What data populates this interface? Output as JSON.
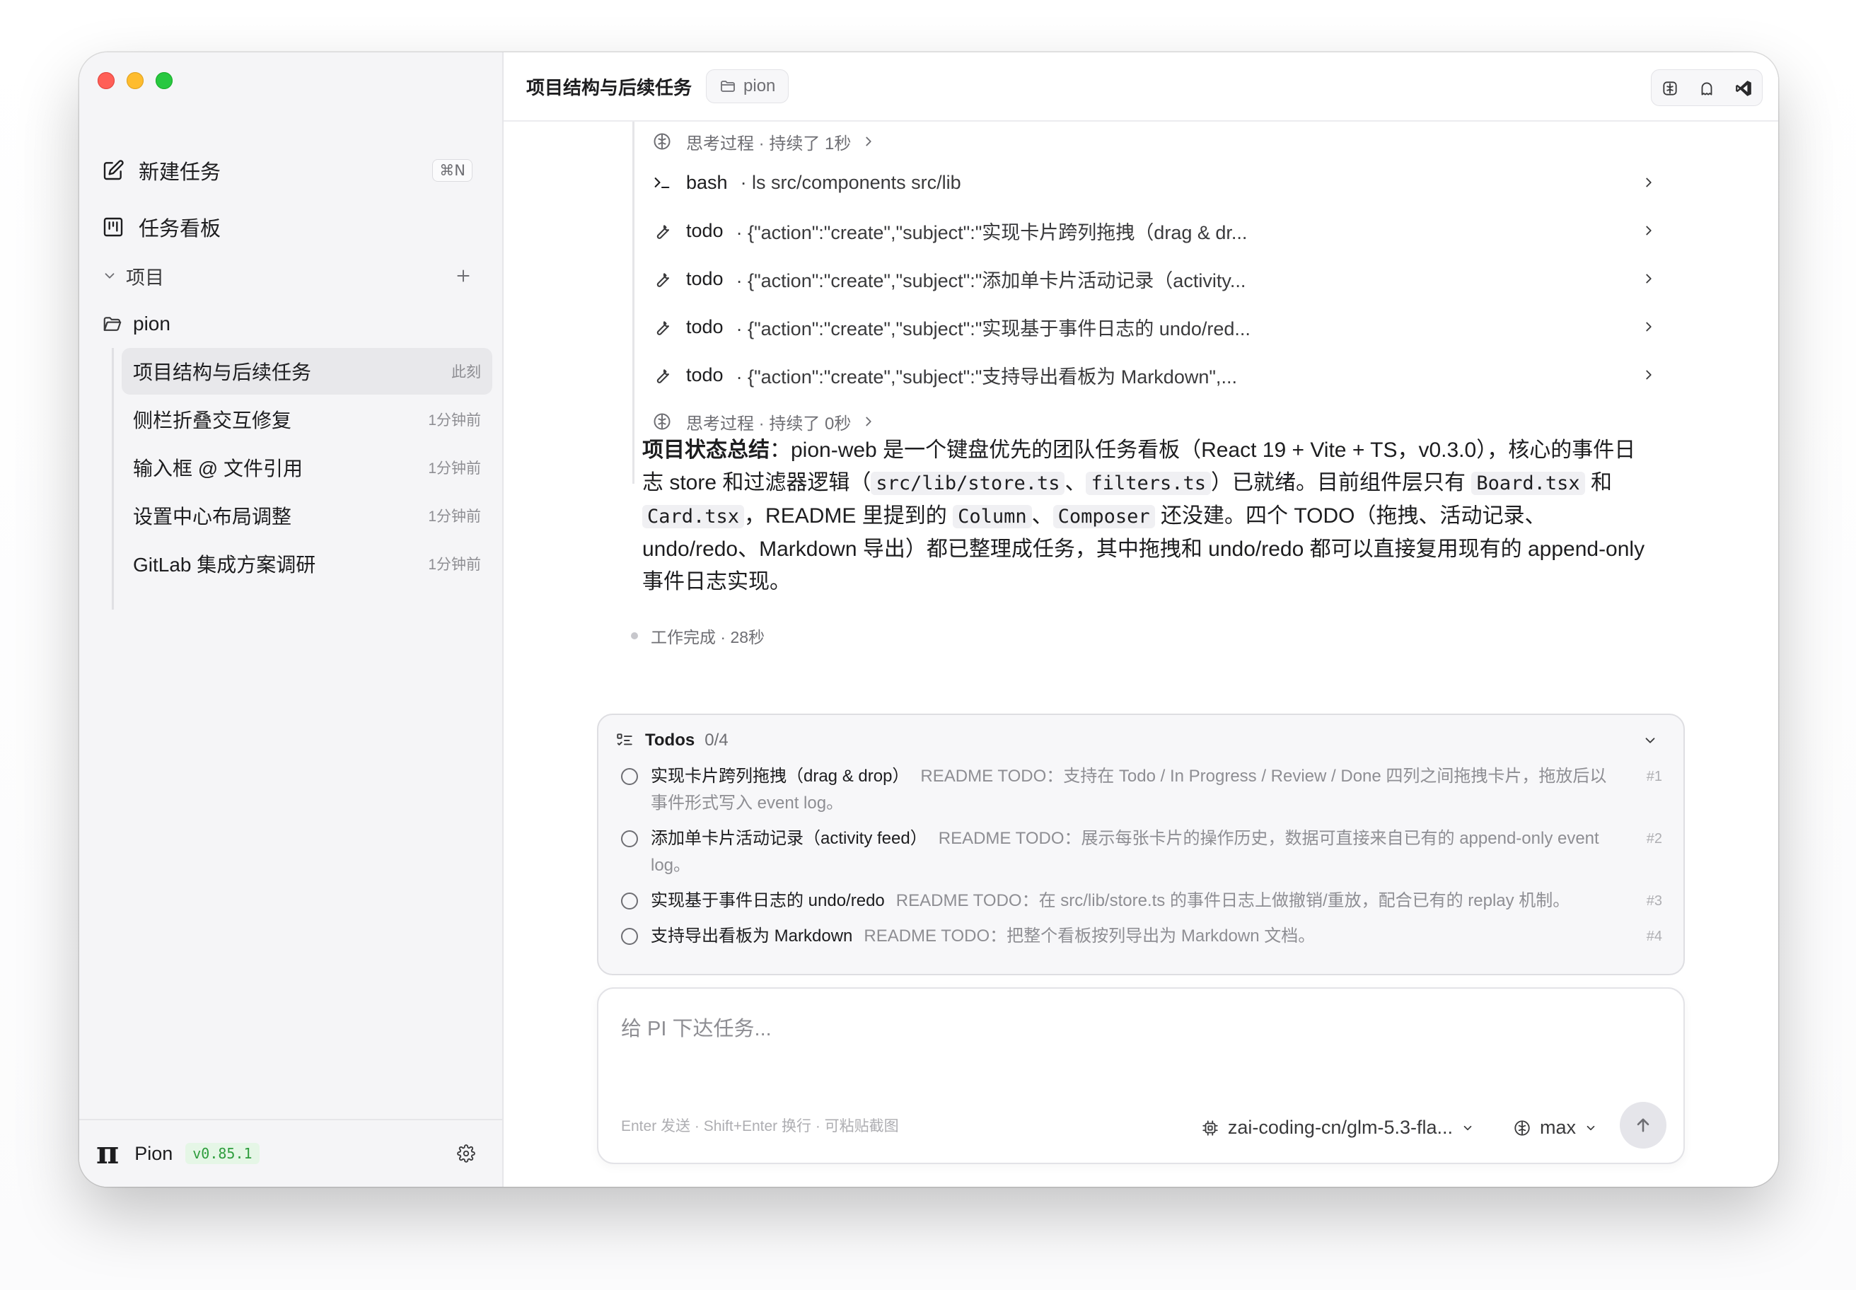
{
  "sidebar": {
    "new_task": {
      "label": "新建任务",
      "shortcut": "⌘N"
    },
    "board": {
      "label": "任务看板"
    },
    "projects_header": "项目",
    "project": {
      "name": "pion"
    },
    "tasks": [
      {
        "title": "项目结构与后续任务",
        "time": "此刻",
        "active": true
      },
      {
        "title": "侧栏折叠交互修复",
        "time": "1分钟前"
      },
      {
        "title": "输入框 @ 文件引用",
        "time": "1分钟前"
      },
      {
        "title": "设置中心布局调整",
        "time": "1分钟前"
      },
      {
        "title": "GitLab 集成方案调研",
        "time": "1分钟前"
      }
    ],
    "footer": {
      "logo": "π",
      "app_name": "Pion",
      "version": "v0.85.1"
    }
  },
  "header": {
    "title": "项目结构与后续任务",
    "project_chip": "pion",
    "actions": [
      "brain-icon",
      "ghost-icon",
      "vscode-icon"
    ]
  },
  "steps": [
    {
      "kind": "think",
      "text": "思考过程 · 持续了 1秒"
    },
    {
      "kind": "tool",
      "tool": "bash",
      "args": "· ls src/components src/lib"
    },
    {
      "kind": "tool",
      "tool": "todo",
      "args": "· {\"action\":\"create\",\"subject\":\"实现卡片跨列拖拽（drag & dr..."
    },
    {
      "kind": "tool",
      "tool": "todo",
      "args": "· {\"action\":\"create\",\"subject\":\"添加单卡片活动记录（activity..."
    },
    {
      "kind": "tool",
      "tool": "todo",
      "args": "· {\"action\":\"create\",\"subject\":\"实现基于事件日志的 undo/red..."
    },
    {
      "kind": "tool",
      "tool": "todo",
      "args": "· {\"action\":\"create\",\"subject\":\"支持导出看板为 Markdown\",..."
    },
    {
      "kind": "think",
      "text": "思考过程 · 持续了 0秒"
    }
  ],
  "summary": {
    "lead": "项目状态总结",
    "p1": "：pion-web 是一个键盘优先的团队任务看板（React 19 + Vite + TS，v0.3.0），核心的事件日志 store 和过滤器逻辑（",
    "c1": "src/lib/store.ts",
    "s1": "、",
    "c2": "filters.ts",
    "p2": "）已就绪。目前组件层只有 ",
    "c3": "Board.tsx",
    "p3": " 和 ",
    "c4": "Card.tsx",
    "p4": "，README 里提到的 ",
    "c5": "Column",
    "s2": "、",
    "c6": "Composer",
    "p5": " 还没建。四个 TODO（拖拽、活动记录、undo/redo、Markdown 导出）都已整理成任务，其中拖拽和 undo/redo 都可以直接复用现有的 append-only 事件日志实现。"
  },
  "status": "工作完成 · 28秒",
  "todos": {
    "label": "Todos",
    "count": "0/4",
    "items": [
      {
        "subject": "实现卡片跨列拖拽（drag & drop）",
        "desc": "README TODO：支持在 Todo / In Progress / Review / Done 四列之间拖拽卡片，拖放后以事件形式写入 event log。",
        "num": "#1"
      },
      {
        "subject": "添加单卡片活动记录（activity feed）",
        "desc": "README TODO：展示每张卡片的操作历史，数据可直接来自已有的 append-only event log。",
        "num": "#2"
      },
      {
        "subject": "实现基于事件日志的 undo/redo",
        "desc": "README TODO：在 src/lib/store.ts 的事件日志上做撤销/重放，配合已有的 replay 机制。",
        "num": "#3"
      },
      {
        "subject": "支持导出看板为 Markdown",
        "desc": "README TODO：把整个看板按列导出为 Markdown 文档。",
        "num": "#4"
      }
    ]
  },
  "composer": {
    "placeholder": "给 PI 下达任务...",
    "value": "",
    "hint": "Enter 发送 · Shift+Enter 换行 · 可粘贴截图",
    "model": "zai-coding-cn/glm-5.3-fla...",
    "effort": "max"
  },
  "colors": {
    "close": "#ff5f57",
    "minimize": "#febc2e",
    "zoom": "#28c840",
    "version_text": "#2e9d3d",
    "version_bg": "#e5f6e6"
  }
}
